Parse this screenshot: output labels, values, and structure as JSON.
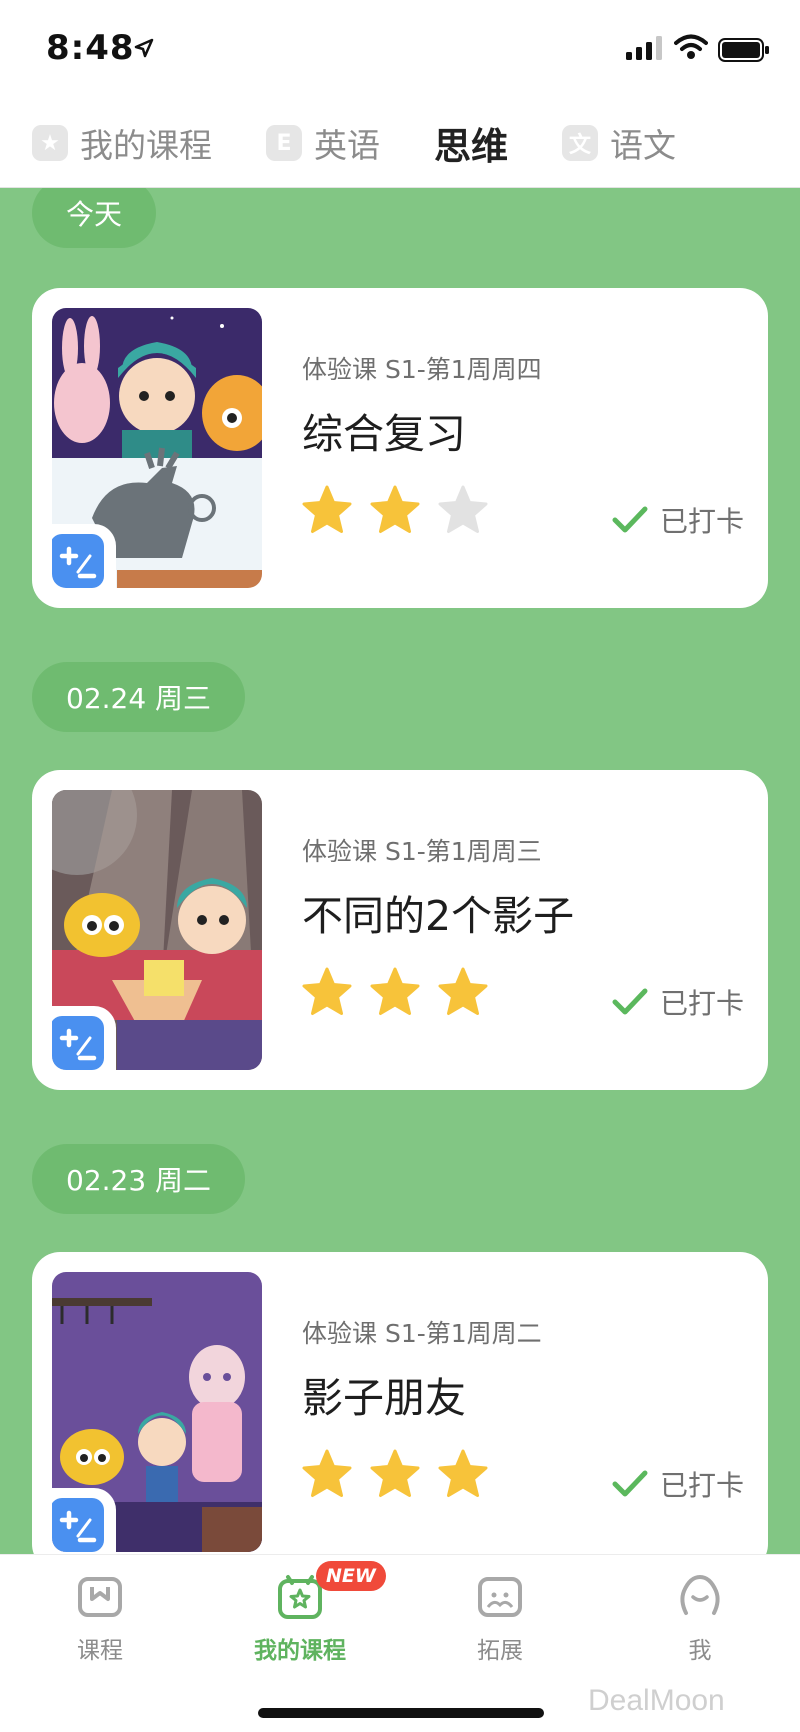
{
  "status_bar": {
    "time": "8:48"
  },
  "top_tabs": [
    {
      "label": "我的课程",
      "icon": "star-icon",
      "icon_char": "★",
      "active": false
    },
    {
      "label": "英语",
      "icon": "letter-e-icon",
      "icon_char": "E",
      "active": false
    },
    {
      "label": "思维",
      "icon": "",
      "icon_char": "",
      "active": true
    },
    {
      "label": "语文",
      "icon": "wen-char-icon",
      "icon_char": "文",
      "active": false
    }
  ],
  "sections": [
    {
      "date": "今天",
      "course": {
        "subtitle": "体验课 S1-第1周周四",
        "title": "综合复习",
        "stars": 2,
        "max_stars": 3,
        "status": "已打卡"
      }
    },
    {
      "date": "02.24 周三",
      "course": {
        "subtitle": "体验课 S1-第1周周三",
        "title": "不同的2个影子",
        "stars": 3,
        "max_stars": 3,
        "status": "已打卡"
      }
    },
    {
      "date": "02.23 周二",
      "course": {
        "subtitle": "体验课 S1-第1周周二",
        "title": "影子朋友",
        "stars": 3,
        "max_stars": 3,
        "status": "已打卡"
      }
    }
  ],
  "bottom_nav": [
    {
      "label": "课程",
      "icon": "course-book-icon",
      "active": false
    },
    {
      "label": "我的课程",
      "icon": "my-course-star-icon",
      "active": true,
      "badge": "NEW"
    },
    {
      "label": "拓展",
      "icon": "expand-face-icon",
      "active": false
    },
    {
      "label": "我",
      "icon": "profile-face-icon",
      "active": false
    }
  ],
  "watermark": "DealMoon",
  "colors": {
    "background": "#82c684",
    "pill": "#6fbb70",
    "star_on": "#f7c33a",
    "star_off": "#e2e2e2",
    "check": "#5bb85d",
    "nav_active": "#5fb35f",
    "badge": "#4a90f0"
  }
}
